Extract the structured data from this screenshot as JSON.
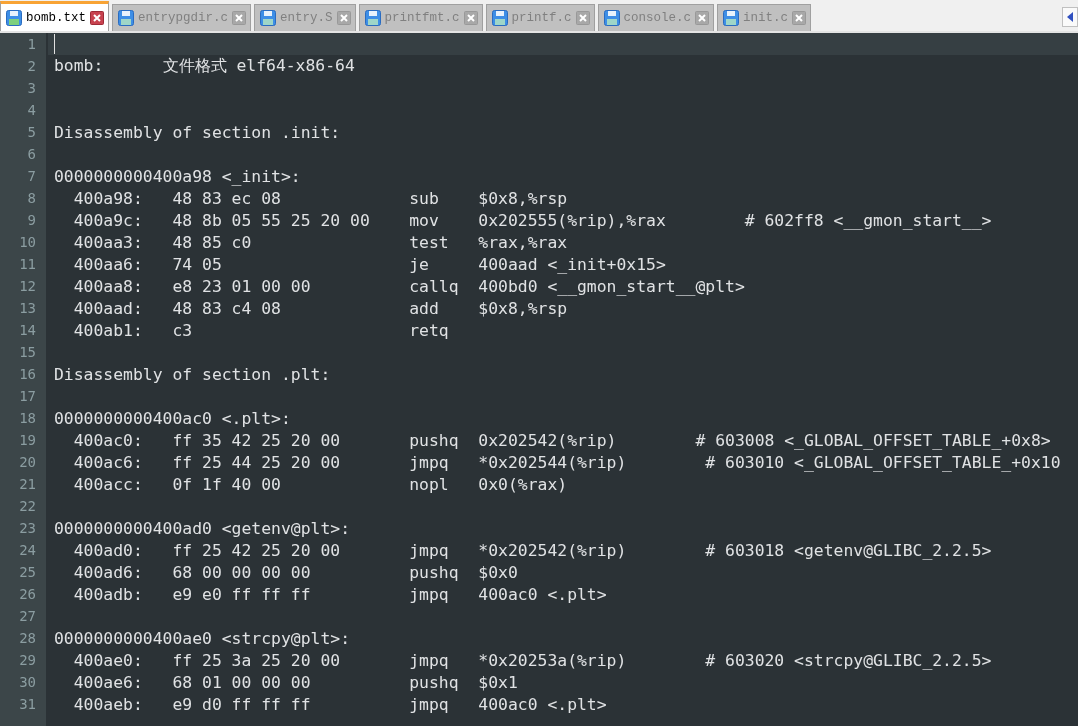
{
  "tabs": [
    {
      "label": "bomb.txt",
      "selected": true
    },
    {
      "label": "entrypgdir.c",
      "selected": false
    },
    {
      "label": "entry.S",
      "selected": false
    },
    {
      "label": "printfmt.c",
      "selected": false
    },
    {
      "label": "printf.c",
      "selected": false
    },
    {
      "label": "console.c",
      "selected": false
    },
    {
      "label": "init.c",
      "selected": false
    }
  ],
  "editor": {
    "lines": [
      {
        "number": "1",
        "current": true
      },
      {
        "number": "2",
        "current": false,
        "text": "bomb:      文件格式 elf64-x86-64"
      },
      {
        "number": "3",
        "current": false
      },
      {
        "number": "4",
        "current": false
      },
      {
        "number": "5",
        "current": false,
        "text": "Disassembly of section .init:"
      },
      {
        "number": "6",
        "current": false
      },
      {
        "number": "7",
        "current": false,
        "text": "0000000000400a98 <_init>:"
      },
      {
        "number": "8",
        "current": false,
        "text": "  400a98:   48 83 ec 08             sub    $0x8,%rsp"
      },
      {
        "number": "9",
        "current": false,
        "text": "  400a9c:   48 8b 05 55 25 20 00    mov    0x202555(%rip),%rax        # 602ff8 <__gmon_start__>"
      },
      {
        "number": "10",
        "current": false,
        "text": "  400aa3:   48 85 c0                test   %rax,%rax"
      },
      {
        "number": "11",
        "current": false,
        "text": "  400aa6:   74 05                   je     400aad <_init+0x15>"
      },
      {
        "number": "12",
        "current": false,
        "text": "  400aa8:   e8 23 01 00 00          callq  400bd0 <__gmon_start__@plt>"
      },
      {
        "number": "13",
        "current": false,
        "text": "  400aad:   48 83 c4 08             add    $0x8,%rsp"
      },
      {
        "number": "14",
        "current": false,
        "text": "  400ab1:   c3                      retq"
      },
      {
        "number": "15",
        "current": false
      },
      {
        "number": "16",
        "current": false,
        "text": "Disassembly of section .plt:"
      },
      {
        "number": "17",
        "current": false
      },
      {
        "number": "18",
        "current": false,
        "text": "0000000000400ac0 <.plt>:"
      },
      {
        "number": "19",
        "current": false,
        "text": "  400ac0:   ff 35 42 25 20 00       pushq  0x202542(%rip)        # 603008 <_GLOBAL_OFFSET_TABLE_+0x8>"
      },
      {
        "number": "20",
        "current": false,
        "text": "  400ac6:   ff 25 44 25 20 00       jmpq   *0x202544(%rip)        # 603010 <_GLOBAL_OFFSET_TABLE_+0x10"
      },
      {
        "number": "21",
        "current": false,
        "text": "  400acc:   0f 1f 40 00             nopl   0x0(%rax)"
      },
      {
        "number": "22",
        "current": false
      },
      {
        "number": "23",
        "current": false,
        "text": "0000000000400ad0 <getenv@plt>:"
      },
      {
        "number": "24",
        "current": false,
        "text": "  400ad0:   ff 25 42 25 20 00       jmpq   *0x202542(%rip)        # 603018 <getenv@GLIBC_2.2.5>"
      },
      {
        "number": "25",
        "current": false,
        "text": "  400ad6:   68 00 00 00 00          pushq  $0x0"
      },
      {
        "number": "26",
        "current": false,
        "text": "  400adb:   e9 e0 ff ff ff          jmpq   400ac0 <.plt>"
      },
      {
        "number": "27",
        "current": false
      },
      {
        "number": "28",
        "current": false,
        "text": "0000000000400ae0 <strcpy@plt>:"
      },
      {
        "number": "29",
        "current": false,
        "text": "  400ae0:   ff 25 3a 25 20 00       jmpq   *0x20253a(%rip)        # 603020 <strcpy@GLIBC_2.2.5>"
      },
      {
        "number": "30",
        "current": false,
        "text": "  400ae6:   68 01 00 00 00          pushq  $0x1"
      },
      {
        "number": "31",
        "current": false,
        "text": "  400aeb:   e9 d0 ff ff ff          jmpq   400ac0 <.plt>"
      }
    ]
  }
}
